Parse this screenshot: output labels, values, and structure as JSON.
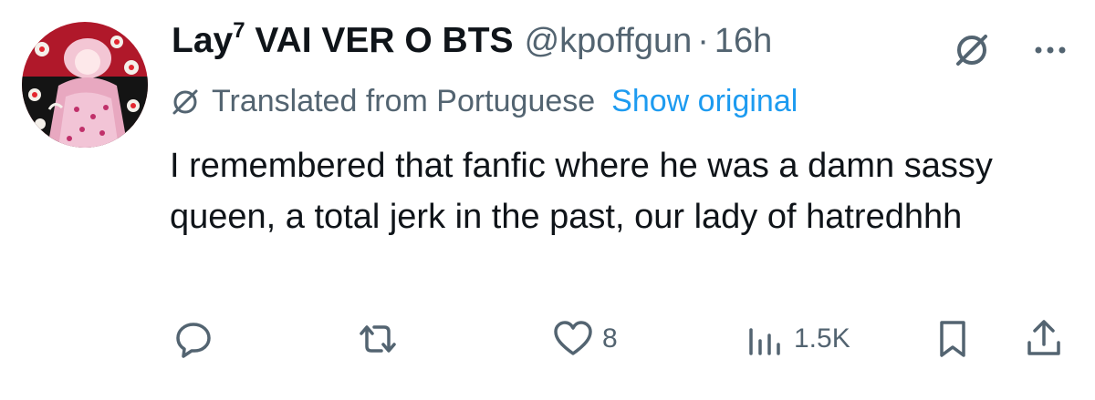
{
  "author": {
    "display_name": "Lay",
    "display_name_superscript": "7",
    "display_name_rest": "VAI VER O BTS",
    "handle": "@kpoffgun",
    "separator": "·",
    "time": "16h"
  },
  "translation": {
    "label": "Translated from Portuguese",
    "show_original_label": "Show original"
  },
  "tweet": {
    "text": "I remembered that fanfic where he was a damn sassy queen, a total jerk in the past, our lady of hatredhhh"
  },
  "actions": {
    "reply_count": "",
    "retweet_count": "",
    "like_count": "8",
    "views_count": "1.5K"
  },
  "icons": {
    "header_translate": "translate-slash-icon",
    "more": "more-dots-icon",
    "translate_small": "translate-slash-icon",
    "reply": "reply-bubble-icon",
    "retweet": "retweet-icon",
    "like": "heart-icon",
    "views": "bar-chart-icon",
    "bookmark": "bookmark-icon",
    "share": "share-upload-icon"
  },
  "colors": {
    "text_primary": "#0f1419",
    "text_secondary": "#536471",
    "link": "#1d9bf0",
    "background": "#ffffff"
  }
}
